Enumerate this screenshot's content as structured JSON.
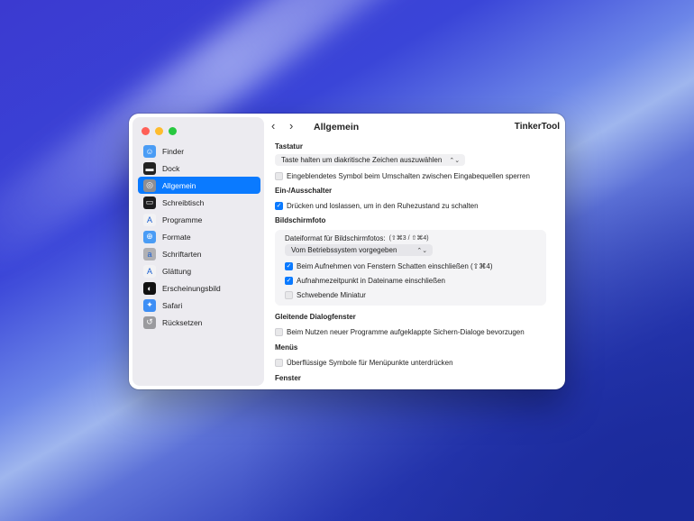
{
  "app_name": "TinkerTool",
  "page_title": "Allgemein",
  "nav": {
    "back": "‹",
    "forward": "›"
  },
  "sidebar": {
    "items": [
      {
        "label": "Finder",
        "icon": "finder-icon",
        "color": "#4a9cf5",
        "glyph": "☺"
      },
      {
        "label": "Dock",
        "icon": "dock-icon",
        "color": "#222222",
        "glyph": "▬"
      },
      {
        "label": "Allgemein",
        "icon": "general-icon",
        "color": "#8e8e93",
        "glyph": "◎",
        "active": true
      },
      {
        "label": "Schreibtisch",
        "icon": "desktop-icon",
        "color": "#1c1c1e",
        "glyph": "▭"
      },
      {
        "label": "Programme",
        "icon": "applications-icon",
        "color": "#f2f2f4",
        "glyph": "A"
      },
      {
        "label": "Formate",
        "icon": "formats-icon",
        "color": "#4a9cf5",
        "glyph": "⊕"
      },
      {
        "label": "Schriftarten",
        "icon": "fonts-icon",
        "color": "#b0b0b4",
        "glyph": "a"
      },
      {
        "label": "Glättung",
        "icon": "smoothing-icon",
        "color": "#f2f2f4",
        "glyph": "A"
      },
      {
        "label": "Erscheinungsbild",
        "icon": "appearance-icon",
        "color": "#111111",
        "glyph": "◐"
      },
      {
        "label": "Safari",
        "icon": "safari-icon",
        "color": "#3d8ef5",
        "glyph": "✦"
      },
      {
        "label": "Rücksetzen",
        "icon": "reset-icon",
        "color": "#9a9a9e",
        "glyph": "↺"
      }
    ]
  },
  "sections": {
    "tastatur": {
      "title": "Tastatur",
      "select": "Taste halten um diakritische Zeichen auszuwählen",
      "cb1": "Eingeblendetes Symbol beim Umschalten zwischen Eingabequellen sperren"
    },
    "power": {
      "title": "Ein-/Ausschalter",
      "cb1": "Drücken und loslassen, um in den Ruhezustand zu schalten"
    },
    "screenshot": {
      "title": "Bildschirmfoto",
      "format_label": "Dateiformat für Bildschirmfotos:",
      "format_shortcut": "(⇧⌘3 / ⇧⌘4)",
      "format_select": "Vom Betriebssystem vorgegeben",
      "cb1": "Beim Aufnehmen von Fenstern Schatten einschließen (⇧⌘4)",
      "cb2": "Aufnahmezeitpunkt in Dateiname einschließen",
      "cb3": "Schwebende Miniatur"
    },
    "dialogs": {
      "title": "Gleitende Dialogfenster",
      "cb1": "Beim Nutzen neuer Programme aufgeklappte Sichern-Dialoge bevorzugen"
    },
    "menus": {
      "title": "Menüs",
      "cb1": "Überflüssige Symbole für Menüpunkte unterdrücken"
    },
    "windows": {
      "title": "Fenster"
    }
  }
}
